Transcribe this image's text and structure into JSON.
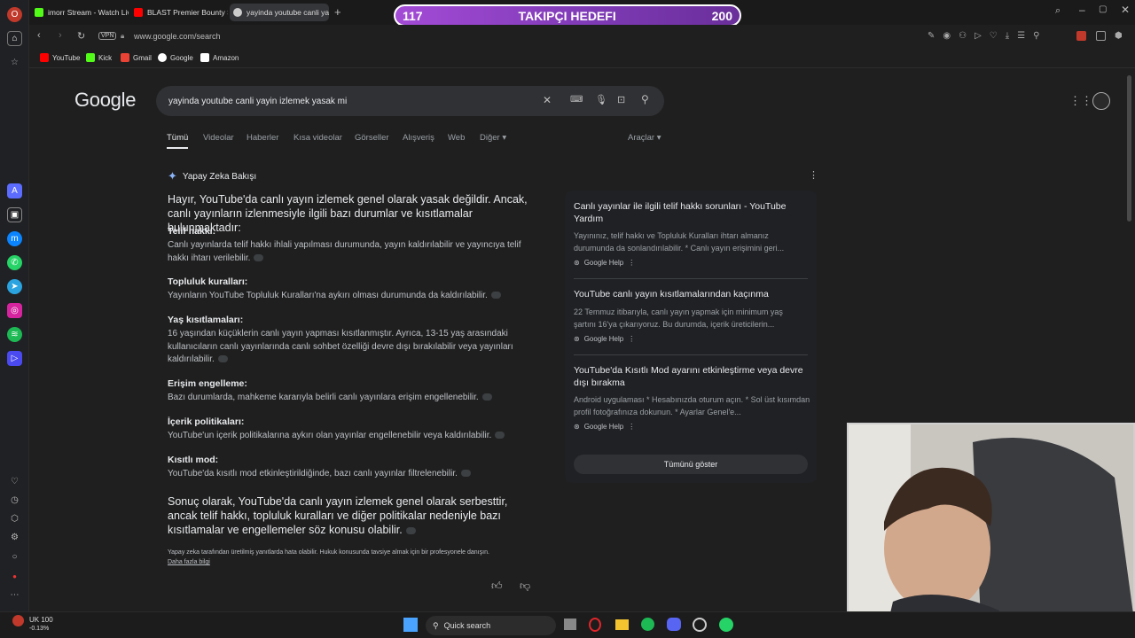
{
  "tabs": [
    {
      "label": "imorr Stream - Watch Live",
      "color": "#53fc18"
    },
    {
      "label": "BLAST Premier Bounty S2",
      "color": "#ff0000"
    },
    {
      "label": "yayinda youtube canli yay",
      "color": "#cccccc",
      "active": true
    }
  ],
  "goal": {
    "current": "117",
    "label": "TAKIPÇI HEDEFI",
    "target": "200",
    "progress": 0.585
  },
  "address": {
    "vpn": "VPN",
    "url": "www.google.com/search"
  },
  "bookmarks": [
    "YouTube",
    "Kick",
    "Gmail",
    "Google",
    "Amazon"
  ],
  "google": {
    "logo": "Google",
    "query": "yayinda youtube canli yayin izlemek yasak mi",
    "tabs": [
      "Tümü",
      "Videolar",
      "Haberler",
      "Kısa videolar",
      "Görseller",
      "Alışveriş",
      "Web",
      "Diğer"
    ],
    "tools": "Araçlar"
  },
  "overview": {
    "title": "Yapay Zeka Bakışı",
    "intro": "Hayır, YouTube'da canlı yayın izlemek genel olarak yasak değildir. Ancak, canlı yayınların izlenmesiyle ilgili bazı durumlar ve kısıtlamalar bulunmaktadır:",
    "sections": [
      {
        "head": "Telif hakkı:",
        "body": "Canlı yayınlarda telif hakkı ihlali yapılması durumunda, yayın kaldırılabilir ve yayıncıya telif hakkı ihtarı verilebilir."
      },
      {
        "head": "Topluluk kuralları:",
        "body": "Yayınların YouTube Topluluk Kuralları'na aykırı olması durumunda da kaldırılabilir."
      },
      {
        "head": "Yaş kısıtlamaları:",
        "body": "16 yaşından küçüklerin canlı yayın yapması kısıtlanmıştır. Ayrıca, 13-15 yaş arasındaki kullanıcıların canlı yayınlarında canlı sohbet özelliği devre dışı bırakılabilir veya yayınları kaldırılabilir."
      },
      {
        "head": "Erişim engelleme:",
        "body": "Bazı durumlarda, mahkeme kararıyla belirli canlı yayınlara erişim engellenebilir."
      },
      {
        "head": "İçerik politikaları:",
        "body": "YouTube'un içerik politikalarına aykırı olan yayınlar engellenebilir veya kaldırılabilir."
      },
      {
        "head": "Kısıtlı mod:",
        "body": "YouTube'da kısıtlı mod etkinleştirildiğinde, bazı canlı yayınlar filtrelenebilir."
      }
    ],
    "conclusion": "Sonuç olarak, YouTube'da canlı yayın izlemek genel olarak serbesttir, ancak telif hakkı, topluluk kuralları ve diğer politikalar nedeniyle bazı kısıtlamalar ve engellemeler söz konusu olabilir.",
    "disclaimer": "Yapay zeka tarafından üretilmiş yanıtlarda hata olabilir. Hukuk konusunda tavsiye almak için bir profesyonele danışın.",
    "more": "Daha fazla bilgi"
  },
  "sources": [
    {
      "title": "Canlı yayınlar ile ilgili telif hakkı sorunları - YouTube Yardım",
      "body": "Yayınınız, telif hakkı ve Topluluk Kuralları ihtarı almanız durumunda da sonlandırılabilir. * Canlı yayın erişimini geri...",
      "site": "Google Help"
    },
    {
      "title": "YouTube canlı yayın kısıtlamalarından kaçınma",
      "body": "22 Temmuz itibarıyla, canlı yayın yapmak için minimum yaş şartını 16'ya çıkarıyoruz. Bu durumda, içerik üreticilerin...",
      "site": "Google Help"
    },
    {
      "title": "YouTube'da Kısıtlı Mod ayarını etkinleştirme veya devre dışı bırakma",
      "body": "Android uygulaması * Hesabınızda oturum açın. * Sol üst kısımdan profil fotoğrafınıza dokunun. * Ayarlar Genel'e...",
      "site": "Google Help"
    }
  ],
  "show_all": "Tümünü göster",
  "taskbar": {
    "stock_name": "UK 100",
    "stock_change": "-0.13%",
    "search": "Quick search"
  }
}
